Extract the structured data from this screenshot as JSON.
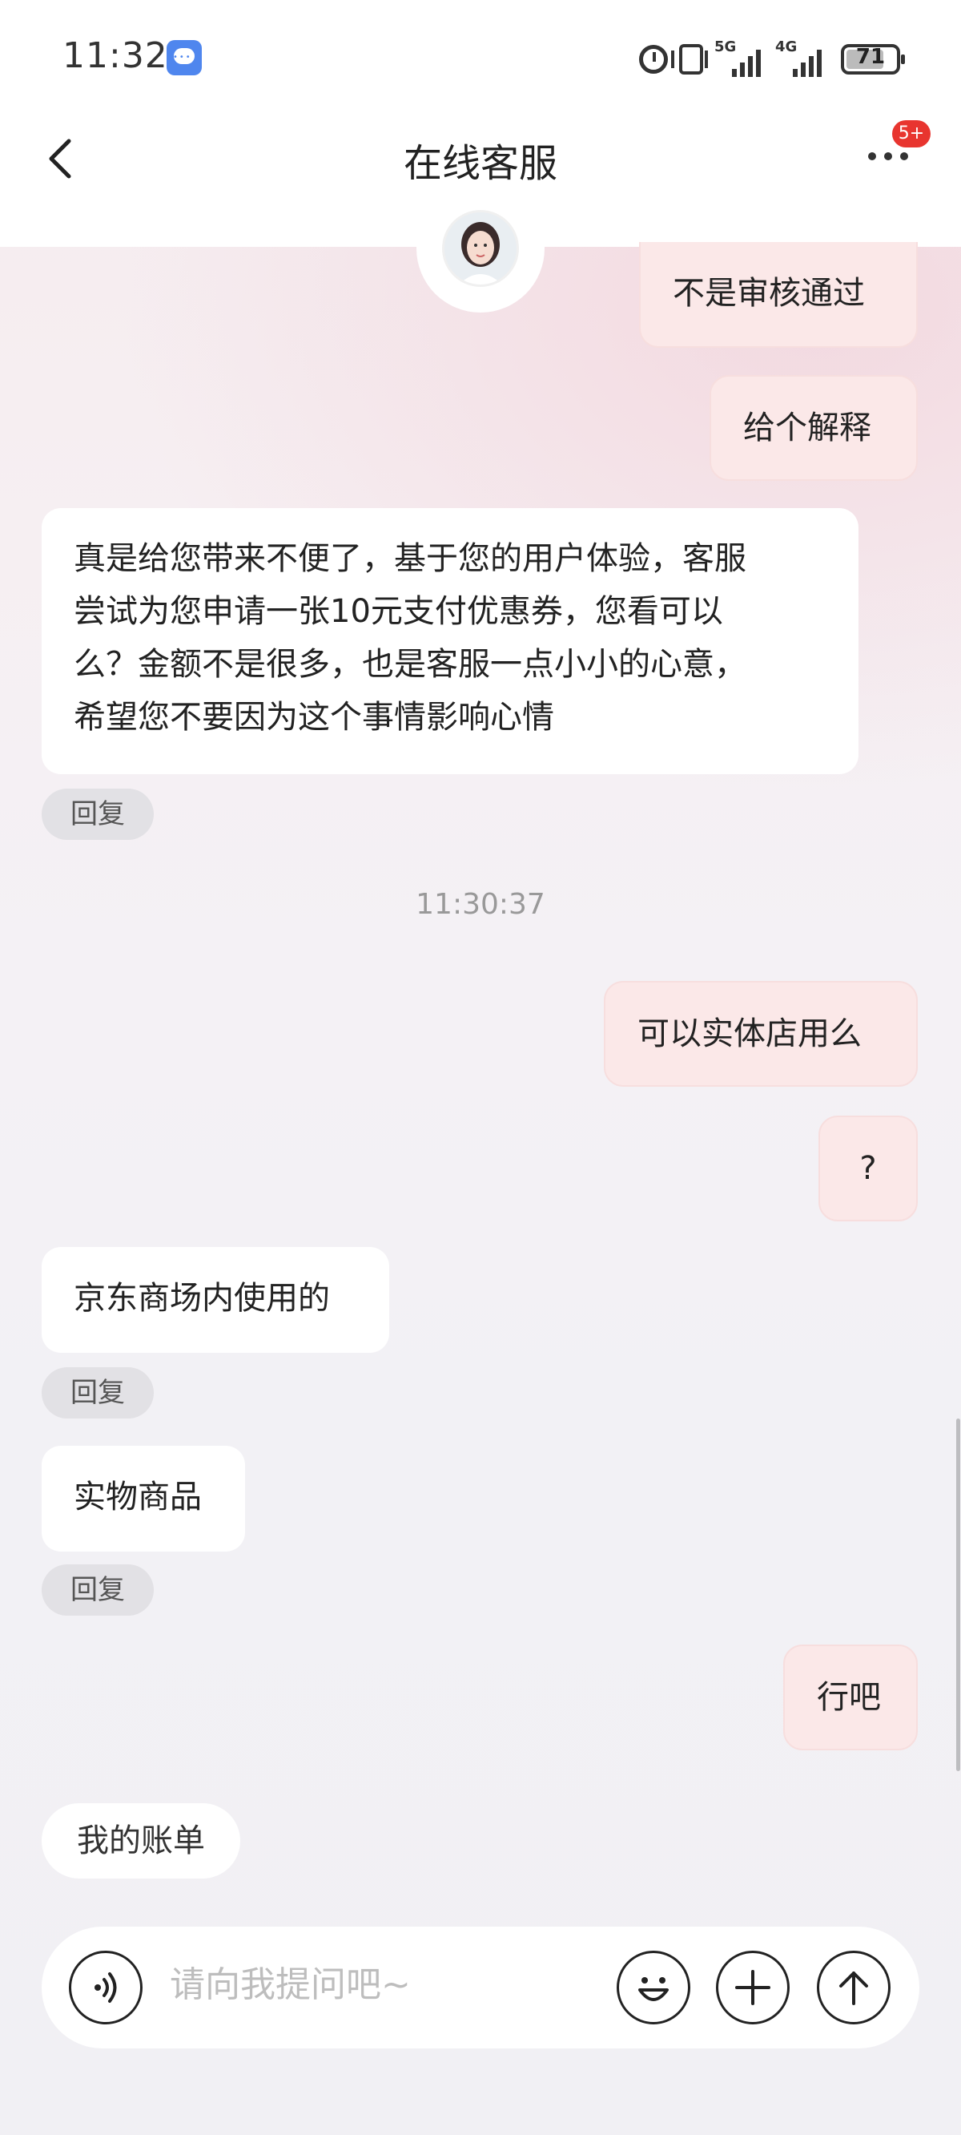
{
  "status_bar": {
    "time": "11:32",
    "net1": "5G",
    "net2": "4G",
    "battery": "71"
  },
  "header": {
    "title": "在线客服",
    "badge": "5+"
  },
  "messages": {
    "m1": "不是审核通过",
    "m2": "给个解释",
    "m3_lines": [
      "真是给您带来不便了，基于您的用户体验，客服",
      "尝试为您申请一张10元支付优惠券，您看可以",
      "么？金额不是很多，也是客服一点小小的心意，",
      "希望您不要因为这个事情影响心情"
    ],
    "timestamp": "11:30:37",
    "m4": "可以实体店用么",
    "m5": "?",
    "m6": "京东商场内使用的",
    "m7": "实物商品",
    "m8": "行吧",
    "reply_label": "回复"
  },
  "quick_reply": "我的账单",
  "input": {
    "placeholder": "请向我提问吧~"
  }
}
